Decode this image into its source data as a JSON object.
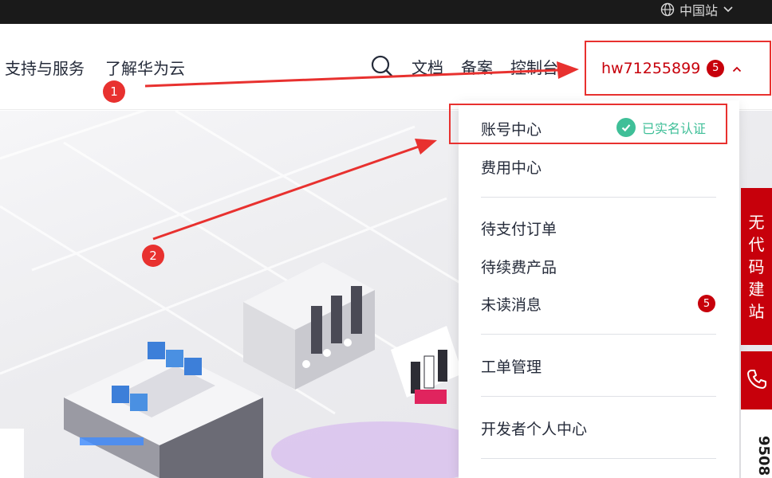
{
  "topbar": {
    "region_label": "中国站"
  },
  "nav": {
    "left_links": [
      "支持与服务",
      "了解华为云"
    ],
    "right_links": [
      "文档",
      "备案",
      "控制台"
    ],
    "user": {
      "name": "hw71255899",
      "badge": "5"
    }
  },
  "dropdown": {
    "account_center": "账号中心",
    "verified_label": "已实名认证",
    "billing_center": "费用中心",
    "pending_orders": "待支付订单",
    "renewal_products": "待续费产品",
    "unread_messages": "未读消息",
    "unread_count": "5",
    "ticket_mgmt": "工单管理",
    "developer_center": "开发者个人中心"
  },
  "side": {
    "promo_chars": [
      "无",
      "代",
      "码",
      "建",
      "站"
    ],
    "phone_number": "9508"
  },
  "annotations": {
    "step1": "1",
    "step2": "2"
  },
  "colors": {
    "brand_red": "#c7000b",
    "annotation_red": "#e8312f",
    "verified_green": "#3fbf98"
  },
  "icons": {
    "region": "globe-icon",
    "search": "search-icon",
    "caret": "chevron-up-icon",
    "verified": "check-circle-icon",
    "phone": "phone-icon"
  }
}
